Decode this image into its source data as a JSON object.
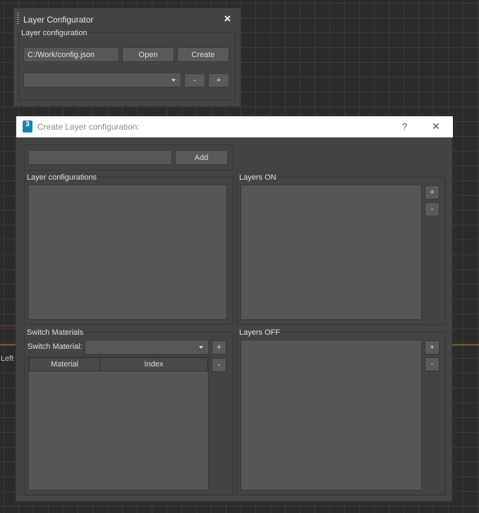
{
  "viewport": {
    "label": "Left"
  },
  "configurator": {
    "title": "Layer Configurator",
    "close_glyph": "✕",
    "group_title": "Layer configuration",
    "path_value": "C:/Work/config.json",
    "open_label": "Open",
    "create_label": "Create",
    "minus_label": "-",
    "plus_label": "+"
  },
  "dialog": {
    "title": "Create Layer configuration:",
    "app_icon_text": "3",
    "help_glyph": "?",
    "close_glyph": "✕",
    "add_label": "Add",
    "layer_configs_title": "Layer configurations",
    "layers_on_title": "Layers ON",
    "layers_off_title": "Layers OFF",
    "switch_materials_title": "Switch Materials",
    "switch_material_label": "Switch Material:",
    "plus_label": "+",
    "minus_label": "-",
    "table_headers": [
      "Material",
      "Index"
    ]
  }
}
